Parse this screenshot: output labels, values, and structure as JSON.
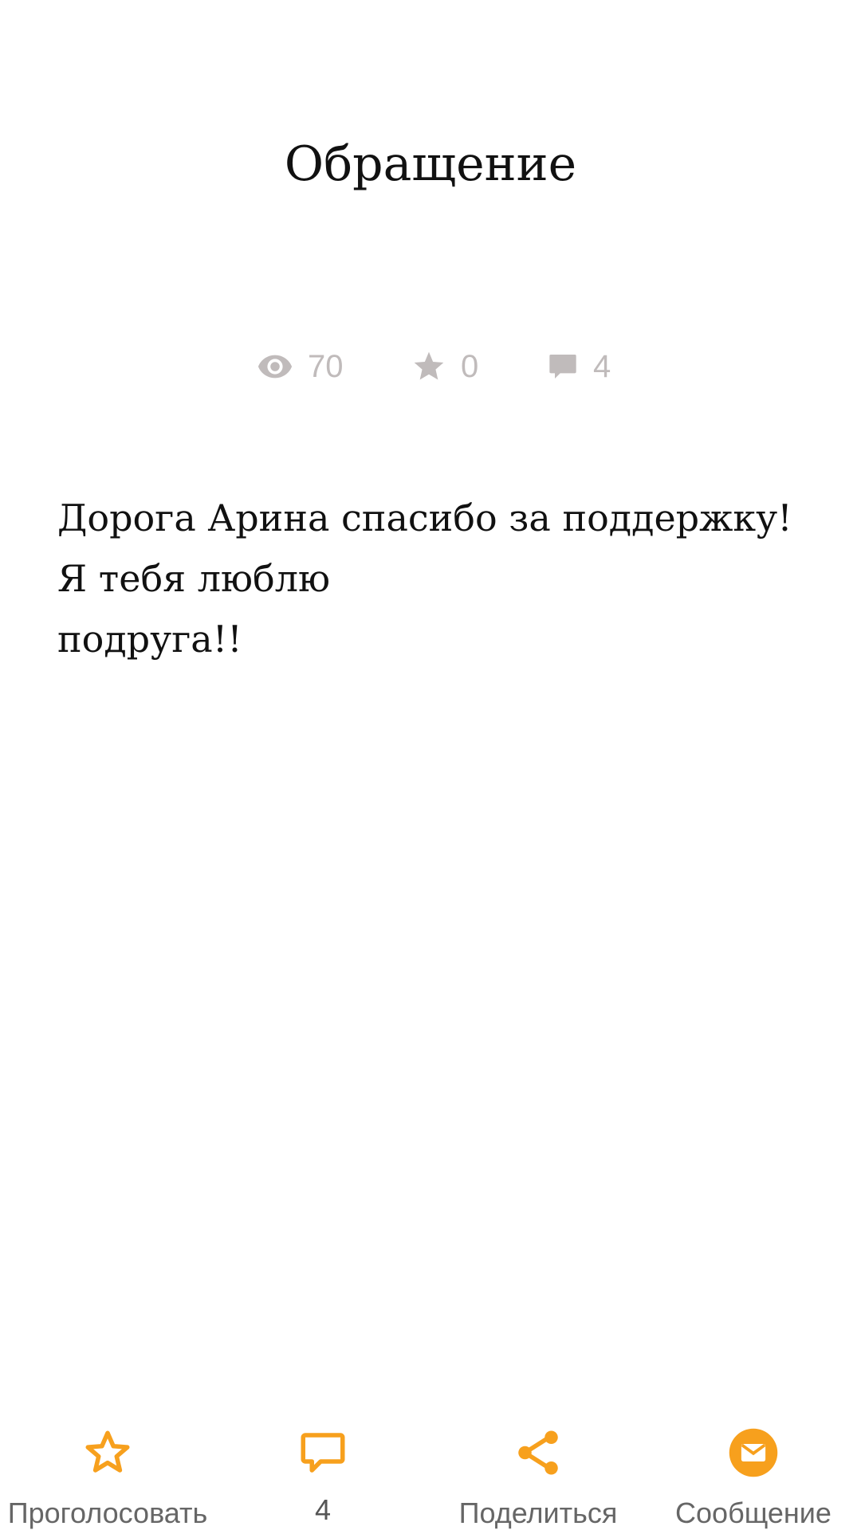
{
  "post": {
    "title": "Обращение",
    "stats": {
      "views": "70",
      "votes": "0",
      "comments": "4"
    },
    "body_lines": [
      "Дорога Арина спасибо за поддержку!",
      "Я тебя люблю",
      "подруга!!"
    ]
  },
  "bottom_bar": {
    "vote_label": "Проголосовать",
    "comments_count": "4",
    "share_label": "Поделиться",
    "message_label": "Сообщение"
  },
  "colors": {
    "accent": "#f7a01d",
    "stat_gray": "#c0bbbb",
    "label_gray": "#666666"
  },
  "icons": {
    "views": "eye-icon",
    "votes": "star-icon",
    "comments": "comment-icon",
    "vote": "star-outline-icon",
    "comments_bar": "comment-outline-icon",
    "share": "share-icon",
    "message": "mail-icon"
  }
}
